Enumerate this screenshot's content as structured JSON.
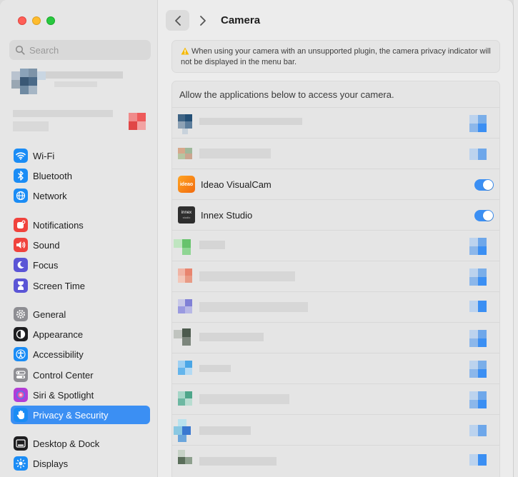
{
  "search": {
    "placeholder": "Search"
  },
  "sidebar": {
    "groups": [
      [
        {
          "label": "Wi-Fi",
          "icon": "wifi-icon",
          "color": "#1a8cf5"
        },
        {
          "label": "Bluetooth",
          "icon": "bluetooth-icon",
          "color": "#1a8cf5"
        },
        {
          "label": "Network",
          "icon": "globe-icon",
          "color": "#1a8cf5"
        }
      ],
      [
        {
          "label": "Notifications",
          "icon": "bell-icon",
          "color": "#f0433d"
        },
        {
          "label": "Sound",
          "icon": "speaker-icon",
          "color": "#f0433d"
        },
        {
          "label": "Focus",
          "icon": "moon-icon",
          "color": "#5b55d6"
        },
        {
          "label": "Screen Time",
          "icon": "hourglass-icon",
          "color": "#5b55d6"
        }
      ],
      [
        {
          "label": "General",
          "icon": "gear-icon",
          "color": "#8e8e93"
        },
        {
          "label": "Appearance",
          "icon": "appearance-icon",
          "color": "#1d1d1f"
        },
        {
          "label": "Accessibility",
          "icon": "accessibility-icon",
          "color": "#1a8cf5"
        },
        {
          "label": "Control Center",
          "icon": "control-center-icon",
          "color": "#8e8e93"
        },
        {
          "label": "Siri & Spotlight",
          "icon": "siri-icon",
          "color": "#b23cd6"
        },
        {
          "label": "Privacy & Security",
          "icon": "hand-icon",
          "color": "#1a8cf5",
          "active": true
        }
      ],
      [
        {
          "label": "Desktop & Dock",
          "icon": "dock-icon",
          "color": "#1d1d1f"
        },
        {
          "label": "Displays",
          "icon": "sun-icon",
          "color": "#1a8cf5"
        }
      ]
    ]
  },
  "main": {
    "title": "Camera",
    "notice": "When using your camera with an unsupported plugin, the camera privacy indicator will not be displayed in the menu bar.",
    "apps_header": "Allow the applications below to access your camera.",
    "visible_apps": [
      {
        "name": "Ideao VisualCam",
        "enabled": true,
        "icon": "ideao-visualcam-icon"
      },
      {
        "name": "Innex Studio",
        "enabled": true,
        "icon": "innex-studio-icon"
      }
    ]
  },
  "colors": {
    "accent": "#3b8ff3",
    "warning": "#f5b800"
  }
}
